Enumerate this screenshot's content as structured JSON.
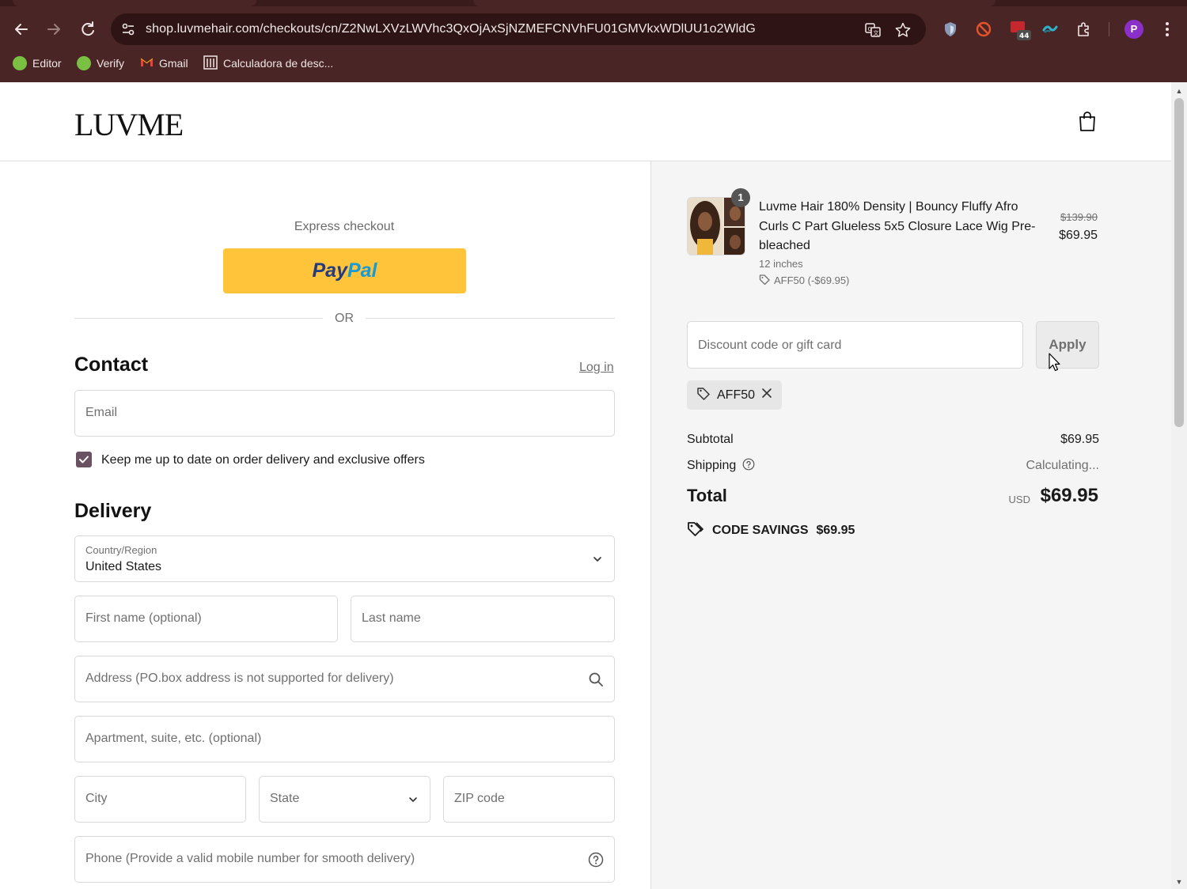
{
  "browser": {
    "url": "shop.luvmehair.com/checkouts/cn/Z2NwLXVzLWVhc3QxOjAxSjNZMEFCNVhFU01GMVkxWDlUU1o2WldG",
    "extension_badge": "44",
    "profile_initial": "P",
    "bookmarks": [
      {
        "label": "Editor"
      },
      {
        "label": "Verify"
      },
      {
        "label": "Gmail"
      },
      {
        "label": "Calculadora de desc..."
      }
    ],
    "colors": {
      "frame": "#4a2525",
      "omnibox": "#2e1414"
    }
  },
  "store": {
    "logo": "LUVME"
  },
  "checkout": {
    "express_label": "Express checkout",
    "paypal_label_a": "Pay",
    "paypal_label_b": "Pal",
    "or_label": "OR",
    "contact_title": "Contact",
    "login_label": "Log in",
    "email_placeholder": "Email",
    "newsletter_checked": true,
    "newsletter_label": "Keep me up to date on order delivery and exclusive offers",
    "delivery_title": "Delivery",
    "country_label": "Country/Region",
    "country_value": "United States",
    "first_name_placeholder": "First name (optional)",
    "last_name_placeholder": "Last name",
    "address_placeholder": "Address (PO.box address is not supported for delivery)",
    "apartment_placeholder": "Apartment, suite, etc. (optional)",
    "city_placeholder": "City",
    "state_placeholder": "State",
    "zip_placeholder": "ZIP code",
    "phone_placeholder": "Phone (Provide a valid mobile number for smooth delivery)"
  },
  "summary": {
    "product": {
      "quantity": "1",
      "name": "Luvme Hair 180% Density | Bouncy Fluffy Afro Curls C Part Glueless 5x5 Closure Lace Wig Pre-bleached",
      "variant": "12 inches",
      "discount": "AFF50 (-$69.95)",
      "old_price": "$139.90",
      "price": "$69.95"
    },
    "discount_placeholder": "Discount code or gift card",
    "apply_label": "Apply",
    "applied_code": "AFF50",
    "subtotal_label": "Subtotal",
    "subtotal_value": "$69.95",
    "shipping_label": "Shipping",
    "shipping_value": "Calculating...",
    "total_label": "Total",
    "total_currency": "USD",
    "total_value": "$69.95",
    "savings_label": "CODE SAVINGS",
    "savings_value": "$69.95"
  }
}
